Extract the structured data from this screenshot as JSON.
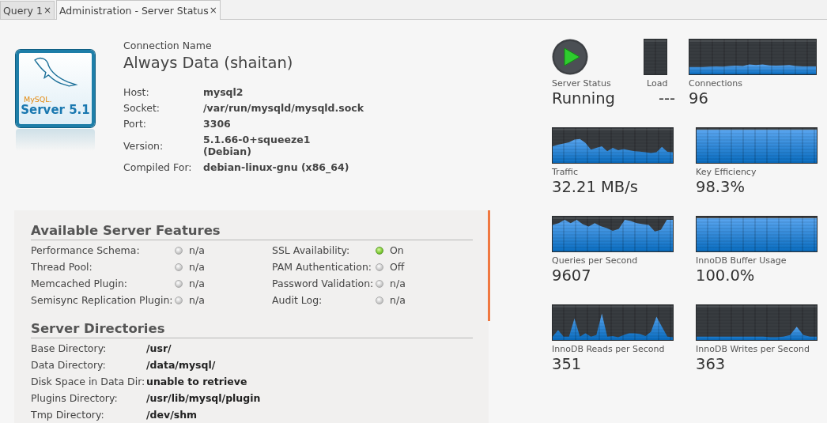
{
  "tabs": [
    {
      "label": "Query 1",
      "selected": false,
      "close": "×"
    },
    {
      "label": "Administration - Server Status",
      "selected": true,
      "close": "×"
    }
  ],
  "logo": {
    "brand": "MySQL.",
    "edition": "Server 5.1"
  },
  "connection": {
    "caption": "Connection Name",
    "name": "Always Data (shaitan)",
    "fields": [
      {
        "label": "Host:",
        "value": "mysql2"
      },
      {
        "label": "Socket:",
        "value": "/var/run/mysqld/mysqld.sock"
      },
      {
        "label": "Port:",
        "value": "3306"
      },
      {
        "label": "Version:",
        "value": "5.1.66-0+squeeze1\n(Debian)"
      },
      {
        "label": "Compiled For:",
        "value": "debian-linux-gnu (x86_64)"
      }
    ]
  },
  "features": {
    "title": "Available Server Features",
    "columns": [
      [
        {
          "label": "Performance Schema:",
          "value": "n/a",
          "on": false
        },
        {
          "label": "Thread Pool:",
          "value": "n/a",
          "on": false
        },
        {
          "label": "Memcached Plugin:",
          "value": "n/a",
          "on": false
        },
        {
          "label": "Semisync Replication Plugin:",
          "value": "n/a",
          "on": false
        }
      ],
      [
        {
          "label": "SSL Availability:",
          "value": "On",
          "on": true
        },
        {
          "label": "PAM Authentication:",
          "value": "Off",
          "on": false
        },
        {
          "label": "Password Validation:",
          "value": "n/a",
          "on": false
        },
        {
          "label": "Audit Log:",
          "value": "n/a",
          "on": false
        }
      ]
    ]
  },
  "directories": {
    "title": "Server Directories",
    "rows": [
      {
        "label": "Base Directory:",
        "value": "/usr/"
      },
      {
        "label": "Data Directory:",
        "value": "/data/mysql/"
      },
      {
        "label": "Disk Space in Data Dir:",
        "value": "unable to retrieve"
      },
      {
        "label": "Plugins Directory:",
        "value": "/usr/lib/mysql/plugin"
      },
      {
        "label": "Tmp Directory:",
        "value": "/dev/shm"
      }
    ]
  },
  "status": {
    "label": "Server Status",
    "value": "Running"
  },
  "load": {
    "label": "Load",
    "value": "---"
  },
  "monitors": [
    {
      "label": "Connections",
      "value": "96"
    },
    {
      "label": "Traffic",
      "value": "32.21 MB/s"
    },
    {
      "label": "Key Efficiency",
      "value": "98.3%"
    },
    {
      "label": "Queries per Second",
      "value": "9607"
    },
    {
      "label": "InnoDB Buffer Usage",
      "value": "100.0%"
    },
    {
      "label": "InnoDB Reads per Second",
      "value": "351"
    },
    {
      "label": "InnoDB Writes per Second",
      "value": "363"
    }
  ]
}
